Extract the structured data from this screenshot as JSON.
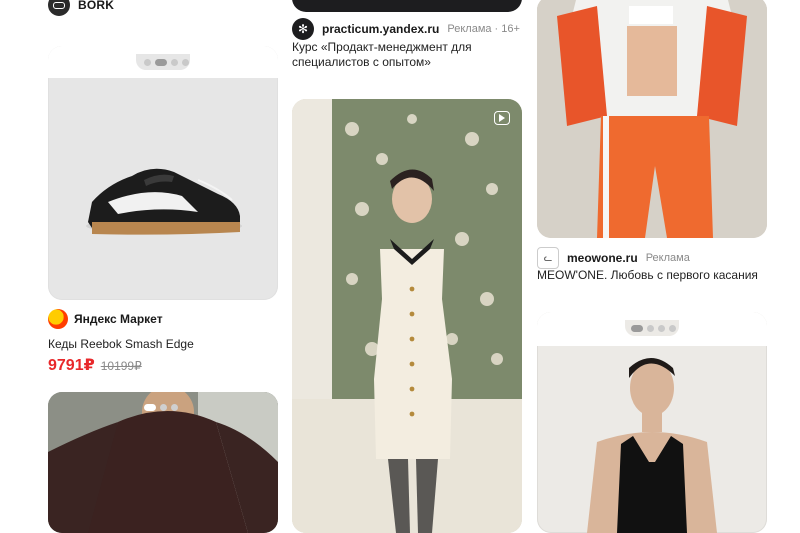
{
  "feed": {
    "col1": {
      "bork": {
        "name": "BORK"
      },
      "product": {
        "shop": "Яндекс Маркет",
        "title": "Кеды Reebok Smash Edge",
        "price_new": "9791₽",
        "price_old": "10199₽"
      }
    },
    "col2": {
      "practicum": {
        "domain": "practicum.yandex.ru",
        "ad_label": "Реклама · 16+",
        "text": "Курс «Продакт-менеджмент для специалистов с опытом»"
      }
    },
    "col3": {
      "meow": {
        "domain": "meowone.ru",
        "ad_label": "Реклама",
        "text": "MEOW'ONE. Любовь с первого касания"
      }
    }
  },
  "icons": {
    "bork_logo": "bork-logo-icon",
    "market_logo": "yandex-market-icon",
    "practicum_logo": "practicum-icon",
    "meow_logo": "meowone-cat-icon",
    "video": "video-play-icon"
  },
  "colors": {
    "price": "#e8282b",
    "old_price": "#8a8a8a",
    "background": "#ffffff"
  }
}
